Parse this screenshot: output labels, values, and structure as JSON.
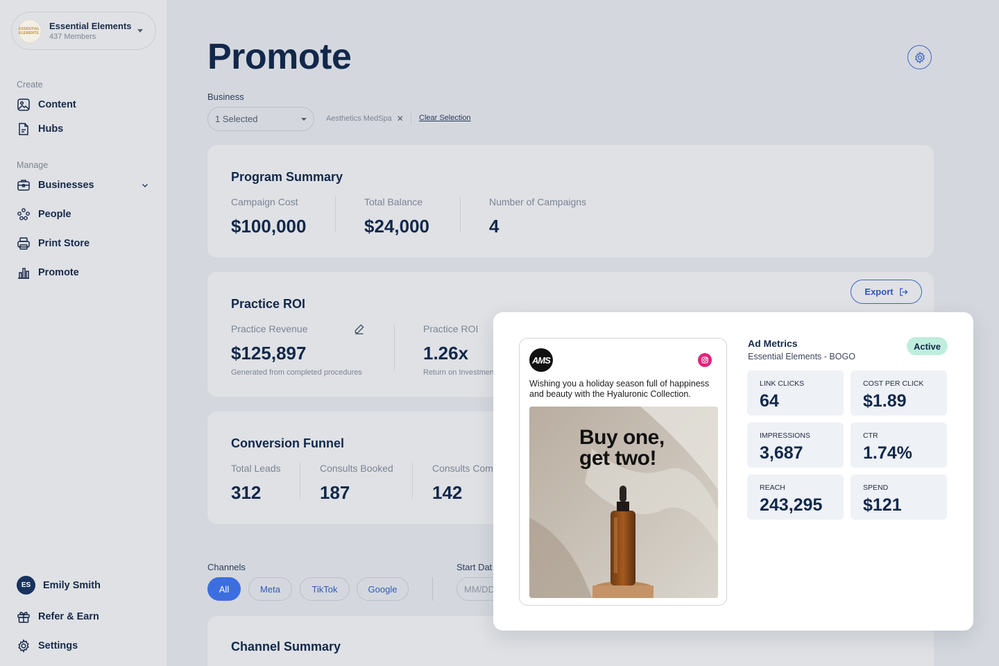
{
  "sidebar": {
    "org": {
      "logo_text": "ESSENTIAL ELEMENTS",
      "name": "Essential Elements",
      "members": "437 Members"
    },
    "create_label": "Create",
    "create_items": [
      {
        "label": "Content",
        "icon": "image-icon"
      },
      {
        "label": "Hubs",
        "icon": "document-icon"
      }
    ],
    "manage_label": "Manage",
    "manage_items": [
      {
        "label": "Businesses",
        "icon": "briefcase-icon"
      },
      {
        "label": "People",
        "icon": "people-icon"
      },
      {
        "label": "Print Store",
        "icon": "printer-icon"
      },
      {
        "label": "Promote",
        "icon": "bar-chart-icon"
      }
    ],
    "user": {
      "initials": "ES",
      "name": "Emily Smith"
    },
    "bottom_items": [
      {
        "label": "Refer & Earn",
        "icon": "gift-icon"
      },
      {
        "label": "Settings",
        "icon": "gear-icon"
      }
    ]
  },
  "header": {
    "title": "Promote"
  },
  "filters": {
    "business_label": "Business",
    "business_select_value": "1 Selected",
    "selected_chip": "Aesthetics MedSpa",
    "clear_label": "Clear Selection"
  },
  "program_summary": {
    "title": "Program Summary",
    "metrics": [
      {
        "label": "Campaign Cost",
        "value": "$100,000"
      },
      {
        "label": "Total Balance",
        "value": "$24,000"
      },
      {
        "label": "Number of Campaigns",
        "value": "4"
      }
    ]
  },
  "practice_roi": {
    "title": "Practice ROI",
    "export_label": "Export",
    "metrics": [
      {
        "label": "Practice Revenue",
        "value": "$125,897",
        "sub": "Generated from completed procedures"
      },
      {
        "label": "Practice ROI",
        "value": "1.26x",
        "sub": "Return on Investmen"
      }
    ]
  },
  "conversion_funnel": {
    "title": "Conversion Funnel",
    "metrics": [
      {
        "label": "Total Leads",
        "value": "312"
      },
      {
        "label": "Consults Booked",
        "value": "187"
      },
      {
        "label": "Consults Com",
        "value": "142"
      }
    ]
  },
  "channels": {
    "label": "Channels",
    "options": [
      "All",
      "Meta",
      "TikTok",
      "Google"
    ],
    "selected": "All",
    "start_date_label": "Start Dat",
    "start_date_placeholder": "MM/DD"
  },
  "channel_summary": {
    "title": "Channel Summary"
  },
  "ad_popup": {
    "brand_logo": "AMS",
    "caption": "Wishing you a holiday season full of happiness and beauty with the Hyaluronic Collection.",
    "headline_line1": "Buy one,",
    "headline_line2": "get two!",
    "metrics_title": "Ad Metrics",
    "campaign_name": "Essential Elements - BOGO",
    "status": "Active",
    "tiles": [
      {
        "label": "LINK CLICKS",
        "value": "64"
      },
      {
        "label": "COST PER CLICK",
        "value": "$1.89"
      },
      {
        "label": "IMPRESSIONS",
        "value": "3,687"
      },
      {
        "label": "CTR",
        "value": "1.74%"
      },
      {
        "label": "REACH",
        "value": "243,295"
      },
      {
        "label": "SPEND",
        "value": "$121"
      }
    ]
  },
  "colors": {
    "accent": "#3d6ee0",
    "navy": "#12284a",
    "status_active_bg": "#bfeedd",
    "instagram": "#e8207a"
  }
}
